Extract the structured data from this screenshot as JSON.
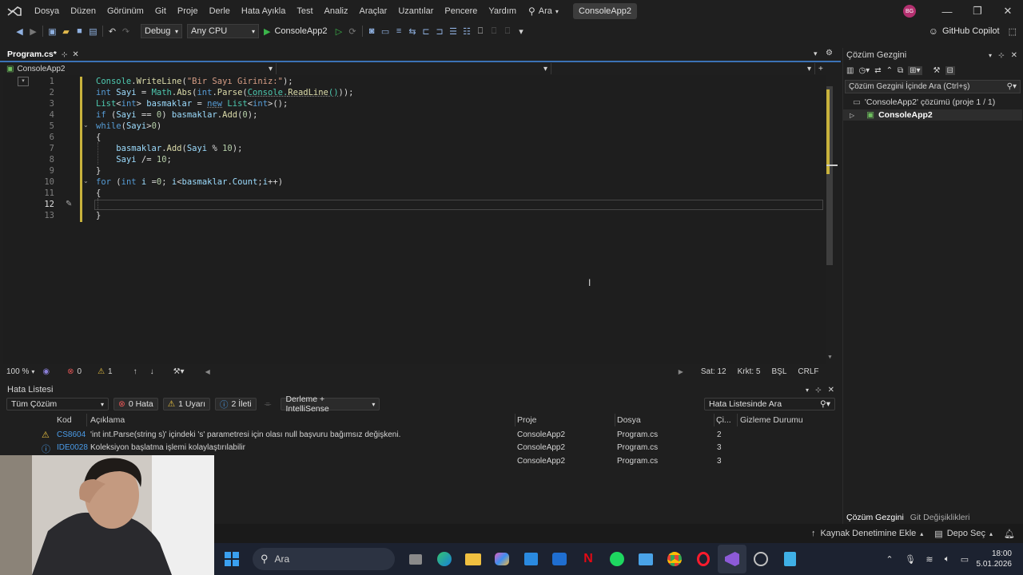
{
  "menubar": {
    "items": [
      "Dosya",
      "Düzen",
      "Görünüm",
      "Git",
      "Proje",
      "Derle",
      "Hata Ayıkla",
      "Test",
      "Analiz",
      "Araçlar",
      "Uzantılar",
      "Pencere",
      "Yardım"
    ],
    "search_label": "Ara",
    "solution_name": "ConsoleApp2",
    "avatar_initials": "BG"
  },
  "toolbar": {
    "config": "Debug",
    "platform": "Any CPU",
    "run_target": "ConsoleApp2",
    "copilot": "GitHub Copilot"
  },
  "editor": {
    "tab_title": "Program.cs*",
    "nav_project": "ConsoleApp2",
    "lines": [
      "1",
      "2",
      "3",
      "4",
      "5",
      "6",
      "7",
      "8",
      "9",
      "10",
      "11",
      "12",
      "13"
    ],
    "active_line": "12",
    "zoom": "100 %",
    "errors": "0",
    "warnings": "1",
    "line_pos": "Sat: 12",
    "col_pos": "Krkt: 5",
    "mode": "BŞL",
    "eol": "CRLF"
  },
  "error_list": {
    "title": "Hata Listesi",
    "scope": "Tüm Çözüm",
    "errors_btn": "0 Hata",
    "warnings_btn": "1 Uyarı",
    "messages_btn": "2 İleti",
    "build_filter": "Derleme + IntelliSense",
    "search_placeholder": "Hata Listesinde Ara",
    "columns": {
      "code": "Kod",
      "desc": "Açıklama",
      "project": "Proje",
      "file": "Dosya",
      "line": "Çi...",
      "suppress": "Gizleme Durumu"
    },
    "rows": [
      {
        "code": "CS8604",
        "desc": "'int int.Parse(string s)' içindeki 's' parametresi için olası null başvuru bağımsız değişkeni.",
        "project": "ConsoleApp2",
        "file": "Program.cs",
        "line": "2"
      },
      {
        "code": "IDE0028",
        "desc": "Koleksiyon başlatma işlemi kolaylaştırılabilir",
        "project": "ConsoleApp2",
        "file": "Program.cs",
        "line": "3"
      },
      {
        "code": "",
        "desc": "",
        "project": "ConsoleApp2",
        "file": "Program.cs",
        "line": "3"
      }
    ]
  },
  "solution_explorer": {
    "title": "Çözüm Gezgini",
    "search_placeholder": "Çözüm Gezgini İçinde Ara (Ctrl+ş)",
    "solution_node": "'ConsoleApp2' çözümü (proje 1 / 1)",
    "project_node": "ConsoleApp2",
    "tab_solution": "Çözüm Gezgini",
    "tab_git": "Git Değişiklikleri"
  },
  "statusbar": {
    "source_control": "Kaynak Denetimine Ekle",
    "repo": "Depo Seç"
  },
  "taskbar": {
    "search": "Ara",
    "time": "18:00",
    "date": "5.01.2026"
  }
}
